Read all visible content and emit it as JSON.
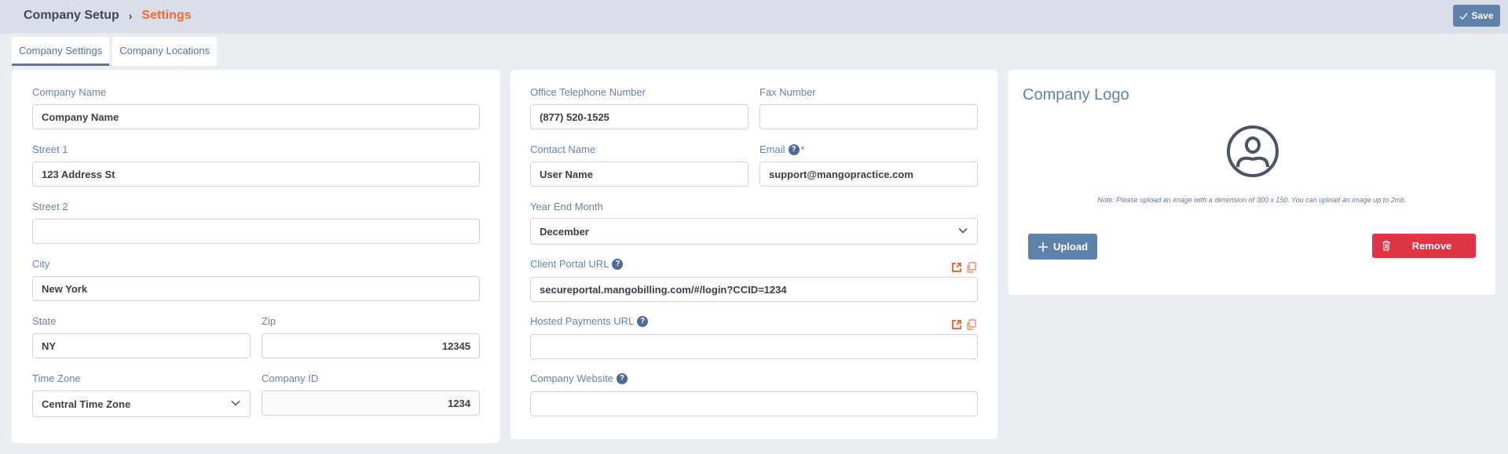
{
  "header": {
    "breadcrumb_root": "Company Setup",
    "breadcrumb_separator": "›",
    "breadcrumb_current": "Settings",
    "save_label": "Save"
  },
  "tabs": [
    {
      "label": "Company Settings",
      "active": true
    },
    {
      "label": "Company Locations",
      "active": false
    }
  ],
  "left_form": {
    "company_name": {
      "label": "Company Name",
      "value": "Company Name"
    },
    "street1": {
      "label": "Street 1",
      "value": "123 Address St"
    },
    "street2": {
      "label": "Street 2",
      "value": ""
    },
    "city": {
      "label": "City",
      "value": "New York"
    },
    "state": {
      "label": "State",
      "value": "NY"
    },
    "zip": {
      "label": "Zip",
      "value": "12345"
    },
    "time_zone": {
      "label": "Time Zone",
      "value": "Central Time Zone"
    },
    "company_id": {
      "label": "Company ID",
      "value": "1234"
    }
  },
  "mid_form": {
    "office_phone": {
      "label": "Office Telephone Number",
      "value": "(877) 520-1525"
    },
    "fax": {
      "label": "Fax Number",
      "value": ""
    },
    "contact_name": {
      "label": "Contact Name",
      "value": "User Name"
    },
    "email": {
      "label": "Email",
      "value": "support@mangopractice.com",
      "required_mark": "*"
    },
    "year_end_month": {
      "label": "Year End Month",
      "value": "December"
    },
    "client_portal_url": {
      "label": "Client Portal URL",
      "value": "secureportal.mangobilling.com/#/login?CCID=1234"
    },
    "hosted_payments_url": {
      "label": "Hosted Payments URL",
      "value": ""
    },
    "company_website": {
      "label": "Company Website",
      "value": ""
    }
  },
  "logo_card": {
    "title": "Company Logo",
    "note": "Note: Please upload an image with a dimension of 300 x 150. You can upload an image up to 2mb.",
    "upload_label": "Upload",
    "remove_label": "Remove"
  },
  "colors": {
    "accent": "#f16a36",
    "primary_button": "#5f82ab",
    "danger_button": "#dd3545",
    "label": "#6683ad"
  }
}
